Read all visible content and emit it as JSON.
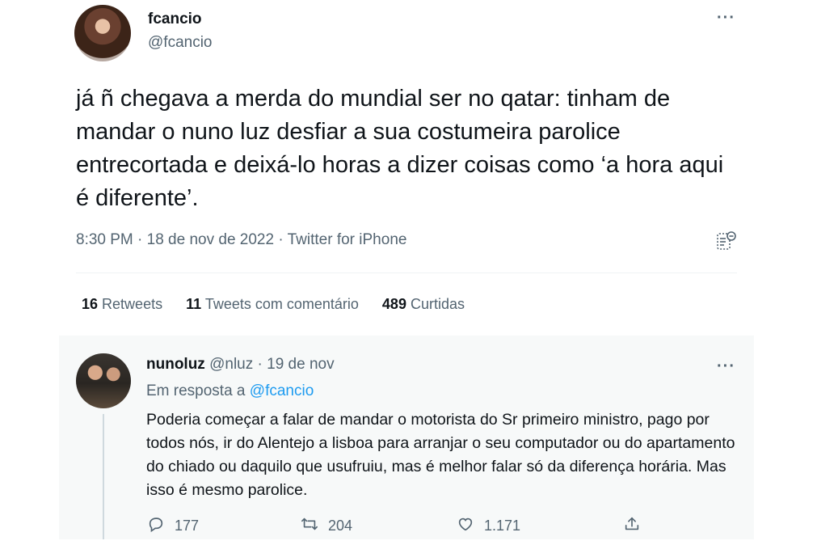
{
  "tweet": {
    "author_name": "fcancio",
    "author_handle": "@fcancio",
    "more_icon": "more-horizontal-icon",
    "text": "já ñ chegava a merda do mundial ser no qatar: tinham de mandar o nuno luz desfiar a sua costumeira parolice entrecortada e deixá-lo horas a dizer coisas como ‘a hora aqui é diferente’.",
    "meta": "8:30 PM · 18 de nov de 2022 · Twitter for iPhone",
    "stats": {
      "retweets_count": "16",
      "retweets_label": "Retweets",
      "quotes_count": "11",
      "quotes_label": "Tweets com comentário",
      "likes_count": "489",
      "likes_label": "Curtidas"
    }
  },
  "reply": {
    "author_name": "nunoluz",
    "author_handle": "@nluz",
    "date": "· 19 de nov",
    "reply_to_prefix": "Em resposta a",
    "reply_to_handle": "@fcancio",
    "text": "Poderia começar a falar de mandar o motorista do Sr primeiro ministro, pago por todos nós, ir do Alentejo a lisboa para arranjar o seu computador ou do apartamento do chiado ou daquilo que usufruiu, mas é melhor falar só da diferença horária. Mas isso é mesmo parolice.",
    "actions": {
      "replies": "177",
      "retweets": "204",
      "likes": "1.171"
    }
  },
  "colors": {
    "text": "#0f1419",
    "secondary": "#536471",
    "link": "#1d9bf0",
    "reply_bg": "#f7f9f9"
  }
}
